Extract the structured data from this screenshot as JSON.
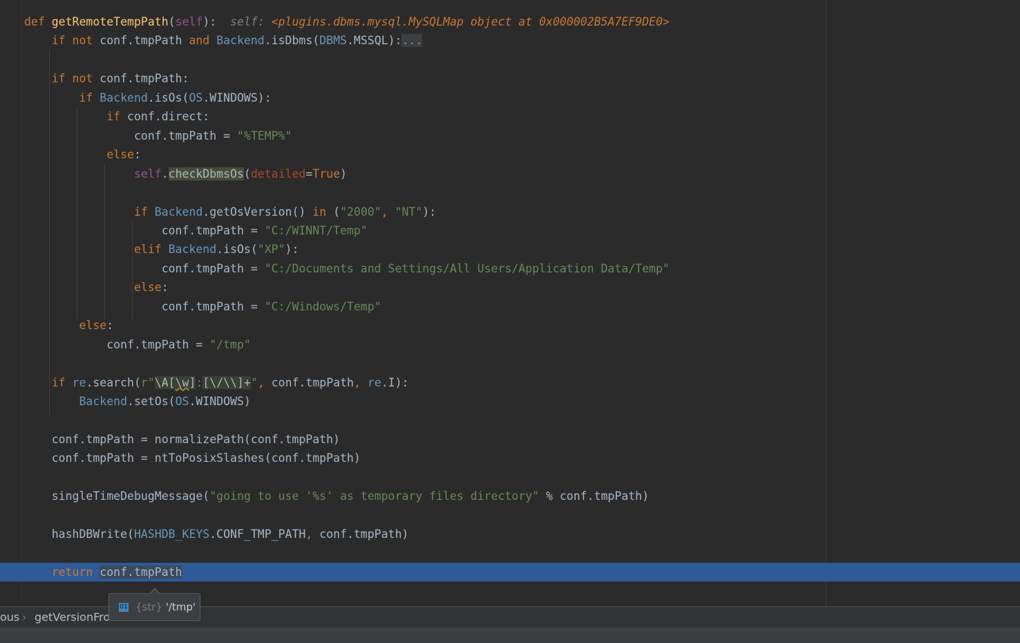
{
  "editor": {
    "lines": [
      {
        "tokens": [
          [
            "kw",
            "def "
          ],
          [
            "fn",
            "getRemoteTempPath"
          ],
          [
            "",
            "("
          ],
          [
            "self",
            "self"
          ],
          [
            "",
            "):  "
          ],
          [
            "inlay",
            "self: "
          ],
          [
            "inlayval",
            "<plugins.dbms.mysql.MySQLMap object at 0x000002B5A7EF9DE0>"
          ]
        ]
      },
      {
        "tokens": [
          [
            "",
            "    "
          ],
          [
            "kw",
            "if not "
          ],
          [
            "",
            "conf.tmpPath "
          ],
          [
            "kw",
            "and "
          ],
          [
            "cls",
            "Backend"
          ],
          [
            "",
            ".isDbms("
          ],
          [
            "cls",
            "DBMS"
          ],
          [
            "",
            ".MSSQL):"
          ],
          [
            "fold",
            "..."
          ]
        ]
      },
      {
        "tokens": []
      },
      {
        "tokens": [
          [
            "",
            "    "
          ],
          [
            "kw",
            "if not "
          ],
          [
            "",
            "conf.tmpPath:"
          ]
        ]
      },
      {
        "tokens": [
          [
            "",
            "        "
          ],
          [
            "kw",
            "if "
          ],
          [
            "cls",
            "Backend"
          ],
          [
            "",
            ".isOs("
          ],
          [
            "cls",
            "OS"
          ],
          [
            "",
            ".WINDOWS):"
          ]
        ]
      },
      {
        "tokens": [
          [
            "",
            "            "
          ],
          [
            "kw",
            "if "
          ],
          [
            "",
            "conf.direct:"
          ]
        ]
      },
      {
        "tokens": [
          [
            "",
            "                "
          ],
          [
            "",
            "conf.tmpPath = "
          ],
          [
            "str",
            "\"%TEMP%\""
          ]
        ]
      },
      {
        "tokens": [
          [
            "",
            "            "
          ],
          [
            "kw",
            "else"
          ],
          [
            "",
            ":"
          ]
        ]
      },
      {
        "tokens": [
          [
            "",
            "                "
          ],
          [
            "self",
            "self"
          ],
          [
            "",
            "."
          ],
          [
            "hl",
            "checkDbmsOs"
          ],
          [
            "",
            "("
          ],
          [
            "param",
            "detailed"
          ],
          [
            "",
            "="
          ],
          [
            "kw",
            "True"
          ],
          [
            "",
            ")"
          ]
        ]
      },
      {
        "tokens": []
      },
      {
        "tokens": [
          [
            "",
            "                "
          ],
          [
            "kw",
            "if "
          ],
          [
            "cls",
            "Backend"
          ],
          [
            "",
            ".getOsVersion() "
          ],
          [
            "kw",
            "in "
          ],
          [
            "",
            "("
          ],
          [
            "str",
            "\"2000\""
          ],
          [
            "kw",
            ", "
          ],
          [
            "str",
            "\"NT\""
          ],
          [
            "",
            "):"
          ]
        ]
      },
      {
        "tokens": [
          [
            "",
            "                    "
          ],
          [
            "",
            "conf.tmpPath = "
          ],
          [
            "str",
            "\"C:/WINNT/Temp\""
          ]
        ]
      },
      {
        "tokens": [
          [
            "",
            "                "
          ],
          [
            "kw",
            "elif "
          ],
          [
            "cls",
            "Backend"
          ],
          [
            "",
            ".isOs("
          ],
          [
            "str",
            "\"XP\""
          ],
          [
            "",
            "):"
          ]
        ]
      },
      {
        "tokens": [
          [
            "",
            "                    "
          ],
          [
            "",
            "conf.tmpPath = "
          ],
          [
            "str",
            "\"C:/Documents and Settings/All Users/Application Data/Temp\""
          ]
        ]
      },
      {
        "tokens": [
          [
            "",
            "                "
          ],
          [
            "kw",
            "else"
          ],
          [
            "",
            ":"
          ]
        ]
      },
      {
        "tokens": [
          [
            "",
            "                    "
          ],
          [
            "",
            "conf.tmpPath = "
          ],
          [
            "str",
            "\"C:/Windows/Temp\""
          ]
        ]
      },
      {
        "tokens": [
          [
            "",
            "        "
          ],
          [
            "kw",
            "else"
          ],
          [
            "",
            ":"
          ]
        ]
      },
      {
        "tokens": [
          [
            "",
            "            "
          ],
          [
            "",
            "conf.tmpPath = "
          ],
          [
            "str",
            "\"/tmp\""
          ]
        ]
      },
      {
        "tokens": []
      },
      {
        "tokens": [
          [
            "",
            "    "
          ],
          [
            "kw",
            "if "
          ],
          [
            "cls",
            "re"
          ],
          [
            "",
            ".search("
          ],
          [
            "str",
            "r\""
          ],
          [
            "rx",
            "\\A"
          ],
          [
            "rx",
            "["
          ],
          [
            "rxw",
            "\\w"
          ],
          [
            "rx",
            "]"
          ],
          [
            "str",
            ":"
          ],
          [
            "rx",
            "["
          ],
          [
            "rx",
            "\\/"
          ],
          [
            "rx",
            "\\\\"
          ],
          [
            "rx",
            "]+"
          ],
          [
            "str",
            "\""
          ],
          [
            "kw",
            ", "
          ],
          [
            "",
            "conf.tmpPath"
          ],
          [
            "kw",
            ", "
          ],
          [
            "cls",
            "re"
          ],
          [
            "",
            ".I):"
          ]
        ]
      },
      {
        "tokens": [
          [
            "",
            "        "
          ],
          [
            "cls",
            "Backend"
          ],
          [
            "",
            ".setOs("
          ],
          [
            "cls",
            "OS"
          ],
          [
            "",
            ".WINDOWS)"
          ]
        ]
      },
      {
        "tokens": []
      },
      {
        "tokens": [
          [
            "",
            "    "
          ],
          [
            "",
            "conf.tmpPath = normalizePath(conf.tmpPath)"
          ]
        ]
      },
      {
        "tokens": [
          [
            "",
            "    "
          ],
          [
            "",
            "conf.tmpPath = ntToPosixSlashes(conf.tmpPath)"
          ]
        ]
      },
      {
        "tokens": []
      },
      {
        "tokens": [
          [
            "",
            "    "
          ],
          [
            "",
            "singleTimeDebugMessage("
          ],
          [
            "str",
            "\"going to use '%s' as temporary files directory\""
          ],
          [
            "",
            " % conf.tmpPath)"
          ]
        ]
      },
      {
        "tokens": []
      },
      {
        "tokens": [
          [
            "",
            "    "
          ],
          [
            "",
            "hashDBWrite("
          ],
          [
            "cls",
            "HASHDB_KEYS"
          ],
          [
            "",
            ".CONF_TMP_PATH"
          ],
          [
            "kw",
            ", "
          ],
          [
            "",
            "conf.tmpPath)"
          ]
        ]
      },
      {
        "tokens": []
      },
      {
        "tokens": [
          [
            "",
            "    "
          ],
          [
            "kw",
            "return "
          ],
          [
            "ret",
            "conf.tmpPath"
          ]
        ]
      }
    ]
  },
  "tooltip": {
    "type_icon": "01",
    "type": "{str}",
    "value": "'/tmp'"
  },
  "breadcrumb": {
    "item1": "ous",
    "separator": "›",
    "item2": "getVersionFrom"
  }
}
